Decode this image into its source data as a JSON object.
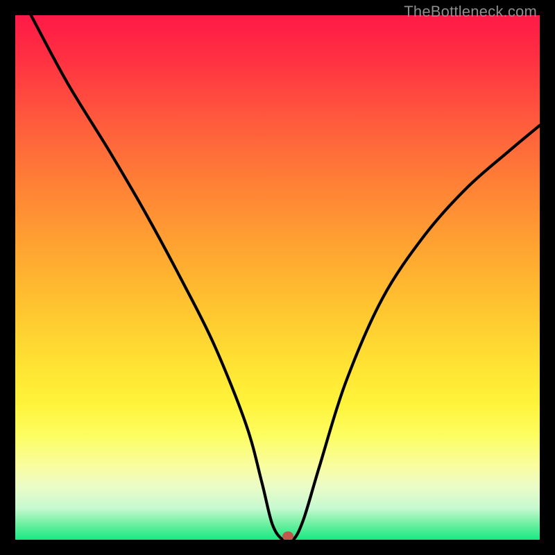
{
  "watermark": "TheBottleneck.com",
  "chart_data": {
    "type": "line",
    "title": "",
    "xlabel": "",
    "ylabel": "",
    "xlim": [
      0,
      100
    ],
    "ylim": [
      0,
      100
    ],
    "series": [
      {
        "name": "bottleneck-curve",
        "x": [
          3,
          10,
          18,
          25,
          32,
          38,
          44,
          47,
          49,
          51,
          53,
          55,
          58,
          63,
          70,
          78,
          86,
          94,
          100
        ],
        "values": [
          100,
          87,
          74,
          62,
          49,
          37,
          22,
          11,
          3,
          0,
          0,
          4,
          14,
          30,
          46,
          58,
          67,
          74,
          79
        ]
      }
    ],
    "marker": {
      "x": 52,
      "y": 0,
      "color": "#c0584b"
    },
    "background_gradient": {
      "top": "#ff1a47",
      "mid_upper": "#ffa331",
      "mid": "#fff33a",
      "mid_lower": "#eafcc8",
      "bottom": "#17e884"
    }
  }
}
